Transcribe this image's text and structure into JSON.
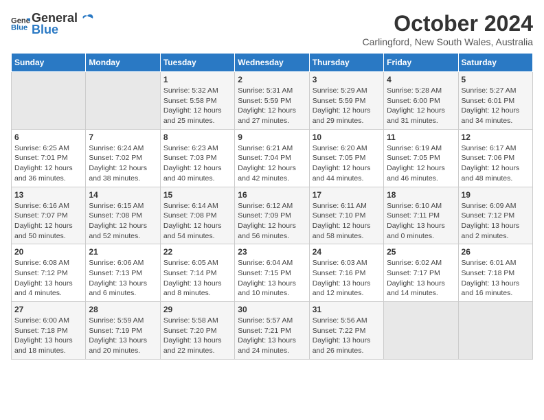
{
  "header": {
    "logo_line1": "General",
    "logo_line2": "Blue",
    "month": "October 2024",
    "location": "Carlingford, New South Wales, Australia"
  },
  "weekdays": [
    "Sunday",
    "Monday",
    "Tuesday",
    "Wednesday",
    "Thursday",
    "Friday",
    "Saturday"
  ],
  "weeks": [
    [
      {
        "day": "",
        "info": ""
      },
      {
        "day": "",
        "info": ""
      },
      {
        "day": "1",
        "info": "Sunrise: 5:32 AM\nSunset: 5:58 PM\nDaylight: 12 hours\nand 25 minutes."
      },
      {
        "day": "2",
        "info": "Sunrise: 5:31 AM\nSunset: 5:59 PM\nDaylight: 12 hours\nand 27 minutes."
      },
      {
        "day": "3",
        "info": "Sunrise: 5:29 AM\nSunset: 5:59 PM\nDaylight: 12 hours\nand 29 minutes."
      },
      {
        "day": "4",
        "info": "Sunrise: 5:28 AM\nSunset: 6:00 PM\nDaylight: 12 hours\nand 31 minutes."
      },
      {
        "day": "5",
        "info": "Sunrise: 5:27 AM\nSunset: 6:01 PM\nDaylight: 12 hours\nand 34 minutes."
      }
    ],
    [
      {
        "day": "6",
        "info": "Sunrise: 6:25 AM\nSunset: 7:01 PM\nDaylight: 12 hours\nand 36 minutes."
      },
      {
        "day": "7",
        "info": "Sunrise: 6:24 AM\nSunset: 7:02 PM\nDaylight: 12 hours\nand 38 minutes."
      },
      {
        "day": "8",
        "info": "Sunrise: 6:23 AM\nSunset: 7:03 PM\nDaylight: 12 hours\nand 40 minutes."
      },
      {
        "day": "9",
        "info": "Sunrise: 6:21 AM\nSunset: 7:04 PM\nDaylight: 12 hours\nand 42 minutes."
      },
      {
        "day": "10",
        "info": "Sunrise: 6:20 AM\nSunset: 7:05 PM\nDaylight: 12 hours\nand 44 minutes."
      },
      {
        "day": "11",
        "info": "Sunrise: 6:19 AM\nSunset: 7:05 PM\nDaylight: 12 hours\nand 46 minutes."
      },
      {
        "day": "12",
        "info": "Sunrise: 6:17 AM\nSunset: 7:06 PM\nDaylight: 12 hours\nand 48 minutes."
      }
    ],
    [
      {
        "day": "13",
        "info": "Sunrise: 6:16 AM\nSunset: 7:07 PM\nDaylight: 12 hours\nand 50 minutes."
      },
      {
        "day": "14",
        "info": "Sunrise: 6:15 AM\nSunset: 7:08 PM\nDaylight: 12 hours\nand 52 minutes."
      },
      {
        "day": "15",
        "info": "Sunrise: 6:14 AM\nSunset: 7:08 PM\nDaylight: 12 hours\nand 54 minutes."
      },
      {
        "day": "16",
        "info": "Sunrise: 6:12 AM\nSunset: 7:09 PM\nDaylight: 12 hours\nand 56 minutes."
      },
      {
        "day": "17",
        "info": "Sunrise: 6:11 AM\nSunset: 7:10 PM\nDaylight: 12 hours\nand 58 minutes."
      },
      {
        "day": "18",
        "info": "Sunrise: 6:10 AM\nSunset: 7:11 PM\nDaylight: 13 hours\nand 0 minutes."
      },
      {
        "day": "19",
        "info": "Sunrise: 6:09 AM\nSunset: 7:12 PM\nDaylight: 13 hours\nand 2 minutes."
      }
    ],
    [
      {
        "day": "20",
        "info": "Sunrise: 6:08 AM\nSunset: 7:12 PM\nDaylight: 13 hours\nand 4 minutes."
      },
      {
        "day": "21",
        "info": "Sunrise: 6:06 AM\nSunset: 7:13 PM\nDaylight: 13 hours\nand 6 minutes."
      },
      {
        "day": "22",
        "info": "Sunrise: 6:05 AM\nSunset: 7:14 PM\nDaylight: 13 hours\nand 8 minutes."
      },
      {
        "day": "23",
        "info": "Sunrise: 6:04 AM\nSunset: 7:15 PM\nDaylight: 13 hours\nand 10 minutes."
      },
      {
        "day": "24",
        "info": "Sunrise: 6:03 AM\nSunset: 7:16 PM\nDaylight: 13 hours\nand 12 minutes."
      },
      {
        "day": "25",
        "info": "Sunrise: 6:02 AM\nSunset: 7:17 PM\nDaylight: 13 hours\nand 14 minutes."
      },
      {
        "day": "26",
        "info": "Sunrise: 6:01 AM\nSunset: 7:18 PM\nDaylight: 13 hours\nand 16 minutes."
      }
    ],
    [
      {
        "day": "27",
        "info": "Sunrise: 6:00 AM\nSunset: 7:18 PM\nDaylight: 13 hours\nand 18 minutes."
      },
      {
        "day": "28",
        "info": "Sunrise: 5:59 AM\nSunset: 7:19 PM\nDaylight: 13 hours\nand 20 minutes."
      },
      {
        "day": "29",
        "info": "Sunrise: 5:58 AM\nSunset: 7:20 PM\nDaylight: 13 hours\nand 22 minutes."
      },
      {
        "day": "30",
        "info": "Sunrise: 5:57 AM\nSunset: 7:21 PM\nDaylight: 13 hours\nand 24 minutes."
      },
      {
        "day": "31",
        "info": "Sunrise: 5:56 AM\nSunset: 7:22 PM\nDaylight: 13 hours\nand 26 minutes."
      },
      {
        "day": "",
        "info": ""
      },
      {
        "day": "",
        "info": ""
      }
    ]
  ]
}
